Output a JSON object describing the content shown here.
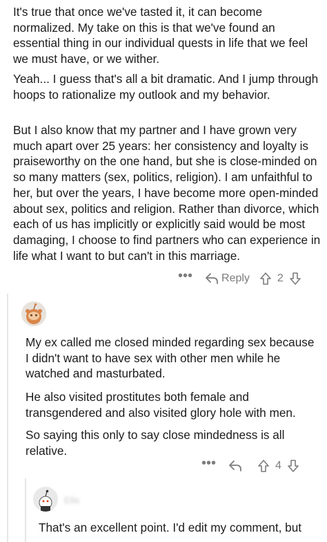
{
  "comment": {
    "paragraphs": [
      "It's true that once we've tasted it, it can become normalized. My take on this is that we've found an essential thing in our individual quests in life that we feel we must have, or we wither.",
      "Yeah... I guess that's all a bit dramatic. And I jump through hoops to rationalize my outlook and my behavior.",
      "But I also know that my partner and I have grown very much apart over 25 years: her consistency and loyalty is praiseworthy on the one hand, but she is close-minded on so many matters (sex, politics, religion). I am unfaithful to her, but over the years, I have become more open-minded about sex, politics and religion. Rather than divorce, which each of us has implicitly or explicitly said would be most damaging, I choose to find partners who can experience in life what I want to but can't in this marriage."
    ],
    "actions": {
      "more": "•••",
      "reply_label": "Reply",
      "vote_count": "2"
    }
  },
  "reply1": {
    "paragraphs": [
      "My ex called me closed minded regarding sex because I didn't want to have sex with other men while he watched and masturbated.",
      "He also visited prostitutes both female and transgendered and also visited glory hole with men.",
      "So saying this only to say close mindedness is all relative."
    ],
    "actions": {
      "more": "•••",
      "vote_count": "4"
    }
  },
  "reply2": {
    "username": "Ella",
    "paragraphs": [
      "That's an excellent point. I'd edit my comment, but"
    ]
  },
  "colors": {
    "text": "#1c1c1c",
    "muted": "#7c7c7c",
    "thread_line": "#e6e6e6",
    "avatar_orange": "#d9864a"
  },
  "icons": [
    "more-icon",
    "reply-icon",
    "upvote-icon",
    "downvote-icon",
    "avatar-icon"
  ]
}
